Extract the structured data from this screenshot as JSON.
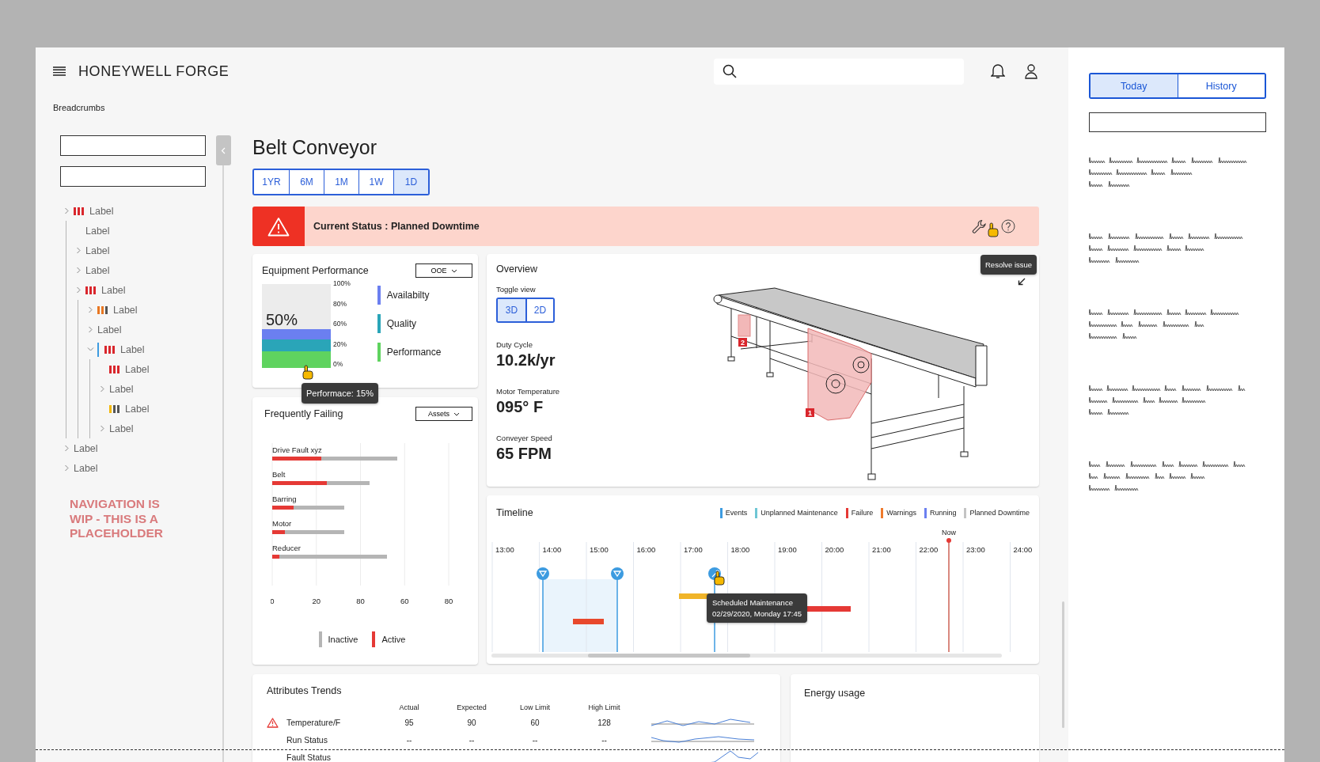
{
  "header": {
    "title": "HONEYWELL FORGE"
  },
  "breadcrumbs": "Breadcrumbs",
  "nav": {
    "tree": [
      {
        "label": "Label",
        "kind": "branch",
        "expanded": false,
        "selected": false,
        "status_bars": [
          {
            "color": "#d9262c"
          },
          {
            "color": "#d9262c"
          },
          {
            "color": "#d9262c"
          }
        ],
        "children": [
          {
            "label": "Label",
            "kind": "leaf",
            "expanded": false,
            "selected": false
          },
          {
            "label": "Label",
            "kind": "branch",
            "expanded": false,
            "selected": false
          },
          {
            "label": "Label",
            "kind": "branch",
            "expanded": false,
            "selected": false
          },
          {
            "label": "Label",
            "kind": "branch",
            "expanded": false,
            "selected": false,
            "status_bars": [
              {
                "color": "#d9262c"
              },
              {
                "color": "#d9262c"
              },
              {
                "color": "#d9262c"
              }
            ],
            "children": [
              {
                "label": "Label",
                "kind": "branch",
                "expanded": false,
                "selected": false,
                "status_bars": [
                  {
                    "color": "#e87722"
                  },
                  {
                    "color": "#e87722"
                  },
                  {
                    "color": "#555555"
                  }
                ]
              },
              {
                "label": "Label",
                "kind": "branch",
                "expanded": false,
                "selected": false
              },
              {
                "label": "Label",
                "kind": "branch",
                "expanded": true,
                "selected": true,
                "status_bars": [
                  {
                    "color": "#d9262c"
                  },
                  {
                    "color": "#d9262c"
                  },
                  {
                    "color": "#d9262c"
                  }
                ],
                "children": [
                  {
                    "label": "Label",
                    "kind": "leaf",
                    "expanded": false,
                    "selected": false,
                    "status_bars": [
                      {
                        "color": "#d9262c"
                      },
                      {
                        "color": "#d9262c"
                      },
                      {
                        "color": "#d9262c"
                      }
                    ]
                  },
                  {
                    "label": "Label",
                    "kind": "branch",
                    "expanded": false,
                    "selected": false
                  },
                  {
                    "label": "Label",
                    "kind": "leaf",
                    "expanded": false,
                    "selected": false,
                    "status_bars": [
                      {
                        "color": "#f2b705"
                      },
                      {
                        "color": "#555555"
                      },
                      {
                        "color": "#555555"
                      }
                    ]
                  },
                  {
                    "label": "Label",
                    "kind": "branch",
                    "expanded": false,
                    "selected": false
                  }
                ]
              }
            ]
          }
        ]
      },
      {
        "label": "Label",
        "kind": "branch",
        "expanded": false,
        "selected": false
      },
      {
        "label": "Label",
        "kind": "branch",
        "expanded": false,
        "selected": false
      }
    ],
    "notice": "NAVIGATION IS WIP - THIS IS A PLACEHOLDER"
  },
  "page_title": "Belt Conveyor",
  "ranges": [
    {
      "label": "1YR",
      "selected": false
    },
    {
      "label": "6M",
      "selected": false
    },
    {
      "label": "1M",
      "selected": false
    },
    {
      "label": "1W",
      "selected": false
    },
    {
      "label": "1D",
      "selected": true
    }
  ],
  "status_banner": {
    "text": "Current Status : Planned Downtime",
    "tooltip": "Resolve issue"
  },
  "equipment_performance": {
    "title": "Equipment Performance",
    "dropdown": "OOE",
    "value": "50%",
    "scale_labels": [
      "100%",
      "80%",
      "60%",
      "20%",
      "0%"
    ],
    "segments": [
      {
        "name": "Availabilty",
        "color": "#6b7ff0"
      },
      {
        "name": "Quality",
        "color": "#2aa5b8"
      },
      {
        "name": "Performance",
        "color": "#5fd35f"
      }
    ],
    "tooltip": "Performace: 15%"
  },
  "frequently_failing": {
    "title": "Frequently Failing",
    "dropdown": "Assets",
    "bar_labels": [
      "Drive Fault xyz",
      "Belt",
      "Barring",
      "Motor",
      "Reducer"
    ],
    "axis_labels": [
      "0",
      "20",
      "80",
      "60",
      "80"
    ],
    "legend": [
      {
        "label": "Inactive",
        "color": "#b5b5b5"
      },
      {
        "label": "Active",
        "color": "#e53935"
      }
    ]
  },
  "overview": {
    "title": "Overview",
    "toggle_label": "Toggle view",
    "toggle": [
      {
        "label": "3D",
        "selected": true
      },
      {
        "label": "2D",
        "selected": false
      }
    ],
    "stats": [
      {
        "label": "Duty Cycle",
        "value": "10.2k/yr"
      },
      {
        "label": "Motor Temperature",
        "value": "095° F"
      },
      {
        "label": "Conveyer Speed",
        "value": "65 FPM"
      }
    ],
    "markers": [
      "2",
      "1"
    ]
  },
  "timeline": {
    "title": "Timeline",
    "legend": [
      {
        "label": "Events",
        "color": "#3d9be0"
      },
      {
        "label": "Unplanned Maintenance",
        "color": "#6ec6d4"
      },
      {
        "label": "Failure",
        "color": "#e53935"
      },
      {
        "label": "Warnings",
        "color": "#ee7a2c"
      },
      {
        "label": "Running",
        "color": "#6b7ff0"
      },
      {
        "label": "Planned Downtime",
        "color": "#c4c4c4"
      }
    ],
    "hours": [
      "13:00",
      "14:00",
      "15:00",
      "16:00",
      "17:00",
      "18:00",
      "19:00",
      "20:00",
      "21:00",
      "22:00",
      "23:00",
      "24:00"
    ],
    "now_label": "Now",
    "tooltip": [
      "Scheduled Maintenance",
      "02/29/2020, Monday 17:45"
    ]
  },
  "attributes": {
    "title": "Attributes Trends",
    "columns": [
      "Actual",
      "Expected",
      "Low Limit",
      "High Limit"
    ],
    "rows": [
      {
        "name": "Temperature/F",
        "warning": true,
        "values": [
          "95",
          "90",
          "60",
          "128"
        ]
      },
      {
        "name": "Run Status",
        "warning": false,
        "values": [
          "--",
          "--",
          "--",
          "--"
        ]
      },
      {
        "name": "Fault Status",
        "warning": false
      }
    ]
  },
  "energy": {
    "title": "Energy usage"
  },
  "side_panel": {
    "tabs": [
      {
        "label": "Today",
        "selected": true
      },
      {
        "label": "History",
        "selected": false
      }
    ]
  }
}
